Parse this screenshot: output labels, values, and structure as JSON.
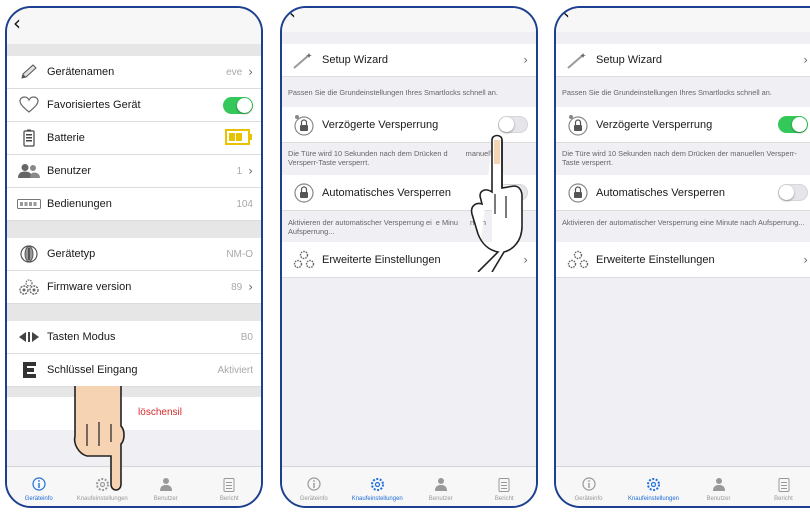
{
  "colors": {
    "frame": "#1c3f8f",
    "toggle_on": "#34c759",
    "tab_active": "#1e6fd9",
    "delete": "#d62b2b",
    "battery": "#e8c300"
  },
  "screen1": {
    "back_icon": "chevron-left-icon",
    "rows": [
      {
        "label": "Gerätenamen",
        "value": "eve",
        "icon": "pencil-icon"
      },
      {
        "label": "Favorisiertes Gerät",
        "icon": "heart-icon",
        "toggle": "on"
      },
      {
        "label": "Batterie",
        "icon": "battery-icon"
      },
      {
        "label": "Benutzer",
        "value": "1",
        "icon": "users-icon"
      },
      {
        "label": "Bedienungen",
        "value": "104",
        "icon": "keypad-icon"
      },
      {
        "label": "Gerätetyp",
        "value": "NM-O",
        "icon": "lock-cylinder-icon"
      },
      {
        "label": "Firmware version",
        "value": "89",
        "icon": "gears-icon"
      },
      {
        "label": "Tasten Modus",
        "value": "B0",
        "icon": "arrows-icon"
      },
      {
        "label": "Schlüssel Eingang",
        "value": "Aktiviert",
        "icon": "letter-e-icon"
      }
    ],
    "delete_label": "löschensil"
  },
  "screen2": {
    "setup_wizard": "Setup Wizard",
    "setup_desc": "Passen Sie die Grundeinstellungen Ihres Smartlocks schnell an.",
    "delayed_lock": "Verzögerte Versperrung",
    "delayed_desc": "Die Türe wird 10 Sekunden nach dem Drücken der manuellen Versperr-Taste versperrt.",
    "delayed_desc_visible": "Die Türe wird 10 Sekunden nach dem Drücken d",
    "delayed_desc_visible_b": "manuellen",
    "delayed_desc_line2": "Versperr-Taste versperrt.",
    "auto_lock": "Automatisches Versperren",
    "auto_desc": "Aktivieren der automatischer Versperrung eine Minute nach Aufsperrung...",
    "auto_desc_a": "Aktivieren der automatischer Versperrung ei",
    "auto_desc_b": "e Minu",
    "auto_desc_c": "nach",
    "auto_desc_line2": "Aufsperrung...",
    "advanced": "Erweiterte Einstellungen",
    "delayed_toggle": "off",
    "auto_toggle": "off"
  },
  "screen3": {
    "setup_wizard": "Setup Wizard",
    "setup_desc": "Passen Sie die Grundeinstellungen Ihres Smartlocks schnell an.",
    "delayed_lock": "Verzögerte Versperrung",
    "delayed_desc": "Die Türe wird 10 Sekunden nach dem Drücken der manuellen Versperr-Taste versperrt.",
    "auto_lock": "Automatisches Versperren",
    "auto_desc": "Aktivieren der automatischer Versperrung eine Minute nach Aufsperrung...",
    "advanced": "Erweiterte Einstellungen",
    "delayed_toggle": "on",
    "auto_toggle": "off"
  },
  "tabs": [
    {
      "label": "Geräteinfo",
      "icon": "info-icon"
    },
    {
      "label": "Knaufeinstellungen",
      "icon": "gear-icon"
    },
    {
      "label": "Benutzer",
      "icon": "user-icon"
    },
    {
      "label": "Bericht",
      "icon": "report-icon"
    }
  ],
  "active_tabs": {
    "screen1": "Geräteinfo",
    "screen2": "Knaufeinstellungen",
    "screen3": "Knaufeinstellungen"
  }
}
